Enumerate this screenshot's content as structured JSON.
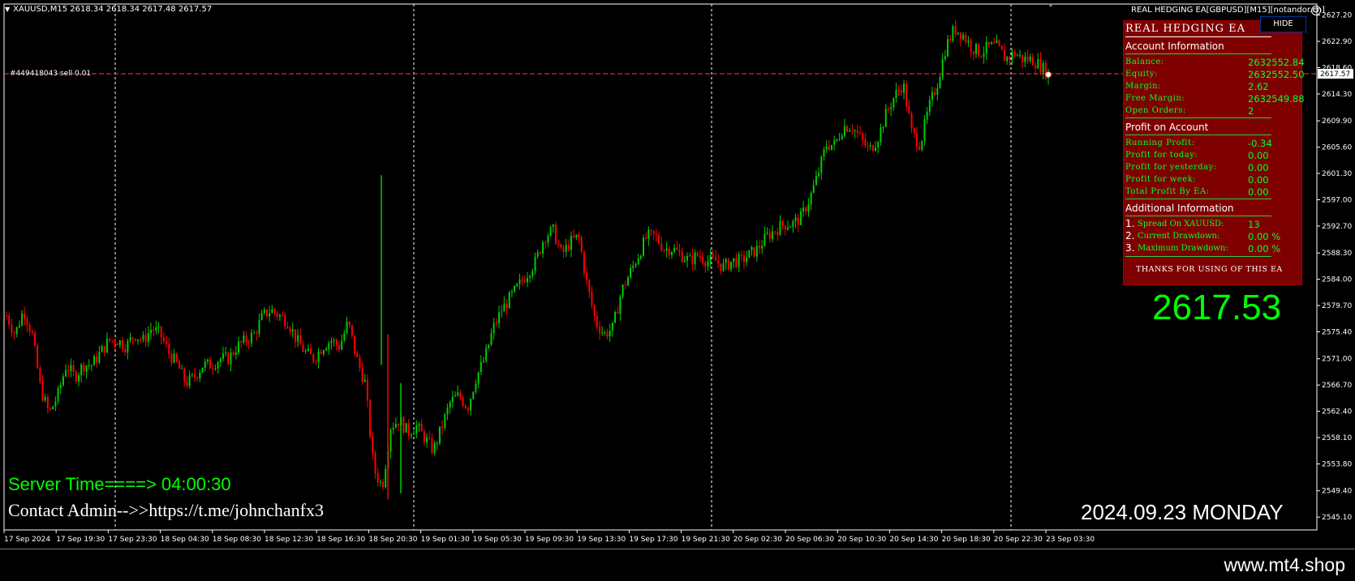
{
  "header": {
    "symbol_info": "XAUUSD,M15  2618.34 2618.34 2617.48 2617.57",
    "ea_name": "REAL HEDGING EA[GBPUSD][M15][notandor.cn]"
  },
  "order_line_label": "#449418043 sell 0.01",
  "price_label": "2617.57",
  "y_axis_ticks": [
    "2627.20",
    "2622.90",
    "2618.60",
    "2614.30",
    "2609.90",
    "2605.60",
    "2601.30",
    "2597.00",
    "2592.70",
    "2588.30",
    "2584.00",
    "2579.70",
    "2575.40",
    "2571.00",
    "2566.70",
    "2562.40",
    "2558.10",
    "2553.80",
    "2549.40",
    "2545.10"
  ],
  "x_axis_ticks": [
    "17 Sep 2024",
    "17 Sep 19:30",
    "17 Sep 23:30",
    "18 Sep 04:30",
    "18 Sep 08:30",
    "18 Sep 12:30",
    "18 Sep 16:30",
    "18 Sep 20:30",
    "19 Sep 01:30",
    "19 Sep 05:30",
    "19 Sep 09:30",
    "19 Sep 13:30",
    "19 Sep 17:30",
    "19 Sep 21:30",
    "20 Sep 02:30",
    "20 Sep 06:30",
    "20 Sep 10:30",
    "20 Sep 14:30",
    "20 Sep 18:30",
    "20 Sep 22:30",
    "23 Sep 03:30"
  ],
  "panel": {
    "hide_label": "HIDE",
    "title": "REAL HEDGING EA",
    "account_section": "Account Information",
    "account": [
      {
        "label": "Balance:",
        "value": "2632552.84"
      },
      {
        "label": "Equity:",
        "value": "2632552.50"
      },
      {
        "label": "Margin:",
        "value": "2.62"
      },
      {
        "label": "Free Margin:",
        "value": "2632549.88"
      },
      {
        "label": "Open Orders:",
        "value": "2"
      }
    ],
    "profit_section": "Profit on Account",
    "profit": [
      {
        "label": "Running Profit:",
        "value": "-0.34"
      },
      {
        "label": "Profit for today:",
        "value": "0.00"
      },
      {
        "label": "Profit for yesterday:",
        "value": "0.00"
      },
      {
        "label": "Profit for week:",
        "value": "0.00"
      },
      {
        "label": "Total Profit By EA:",
        "value": "0.00"
      }
    ],
    "additional_section": "Additional Information",
    "additional": [
      {
        "num": "1.",
        "label": "Spread On XAUUSD:",
        "value": "13"
      },
      {
        "num": "2.",
        "label": "Current Drawdown:",
        "value": "0.00 %"
      },
      {
        "num": "3.",
        "label": "Maximum Drawdown:",
        "value": "0.00 %"
      }
    ],
    "thanks": "THANKS FOR USING OF THIS EA"
  },
  "big_price": "2617.53",
  "server_time": "Server Time====> 04:00:30",
  "contact": "Contact Admin-->>https://t.me/johnchanfx3",
  "date_text": "2024.09.23 MONDAY",
  "footer": "www.mt4.shop",
  "colors": {
    "bull": "#00cc00",
    "bear": "#ff0000",
    "panel": "#7f0000",
    "order_line": "#ff3b3b"
  },
  "price_path": [
    2578,
    2575,
    2579,
    2575,
    2566,
    2562,
    2565,
    2570,
    2568,
    2570,
    2570,
    2572,
    2574,
    2574,
    2573,
    2575,
    2574,
    2576,
    2575,
    2572,
    2570,
    2567,
    2568,
    2570,
    2570,
    2571,
    2571,
    2573,
    2574,
    2575,
    2578,
    2579,
    2578,
    2577,
    2574,
    2572,
    2571,
    2573,
    2574,
    2573,
    2577,
    2571,
    2567,
    2553,
    2550,
    2560,
    2561,
    2559,
    2560,
    2558,
    2556,
    2560,
    2564,
    2565,
    2563,
    2568,
    2571,
    2576,
    2579,
    2581,
    2583,
    2585,
    2587,
    2591,
    2592,
    2588,
    2590,
    2591,
    2583,
    2577,
    2575,
    2576,
    2582,
    2585,
    2588,
    2591,
    2591,
    2589,
    2589,
    2588,
    2587,
    2588,
    2587,
    2587,
    2586,
    2587,
    2587,
    2588,
    2589,
    2591,
    2592,
    2593,
    2593,
    2594,
    2597,
    2601,
    2606,
    2606,
    2609,
    2609,
    2607,
    2605,
    2607,
    2611,
    2614,
    2616,
    2608,
    2606,
    2612,
    2616,
    2622,
    2625,
    2624,
    2622,
    2621,
    2622,
    2622,
    2620,
    2621,
    2620,
    2620,
    2619,
    2617.5
  ]
}
